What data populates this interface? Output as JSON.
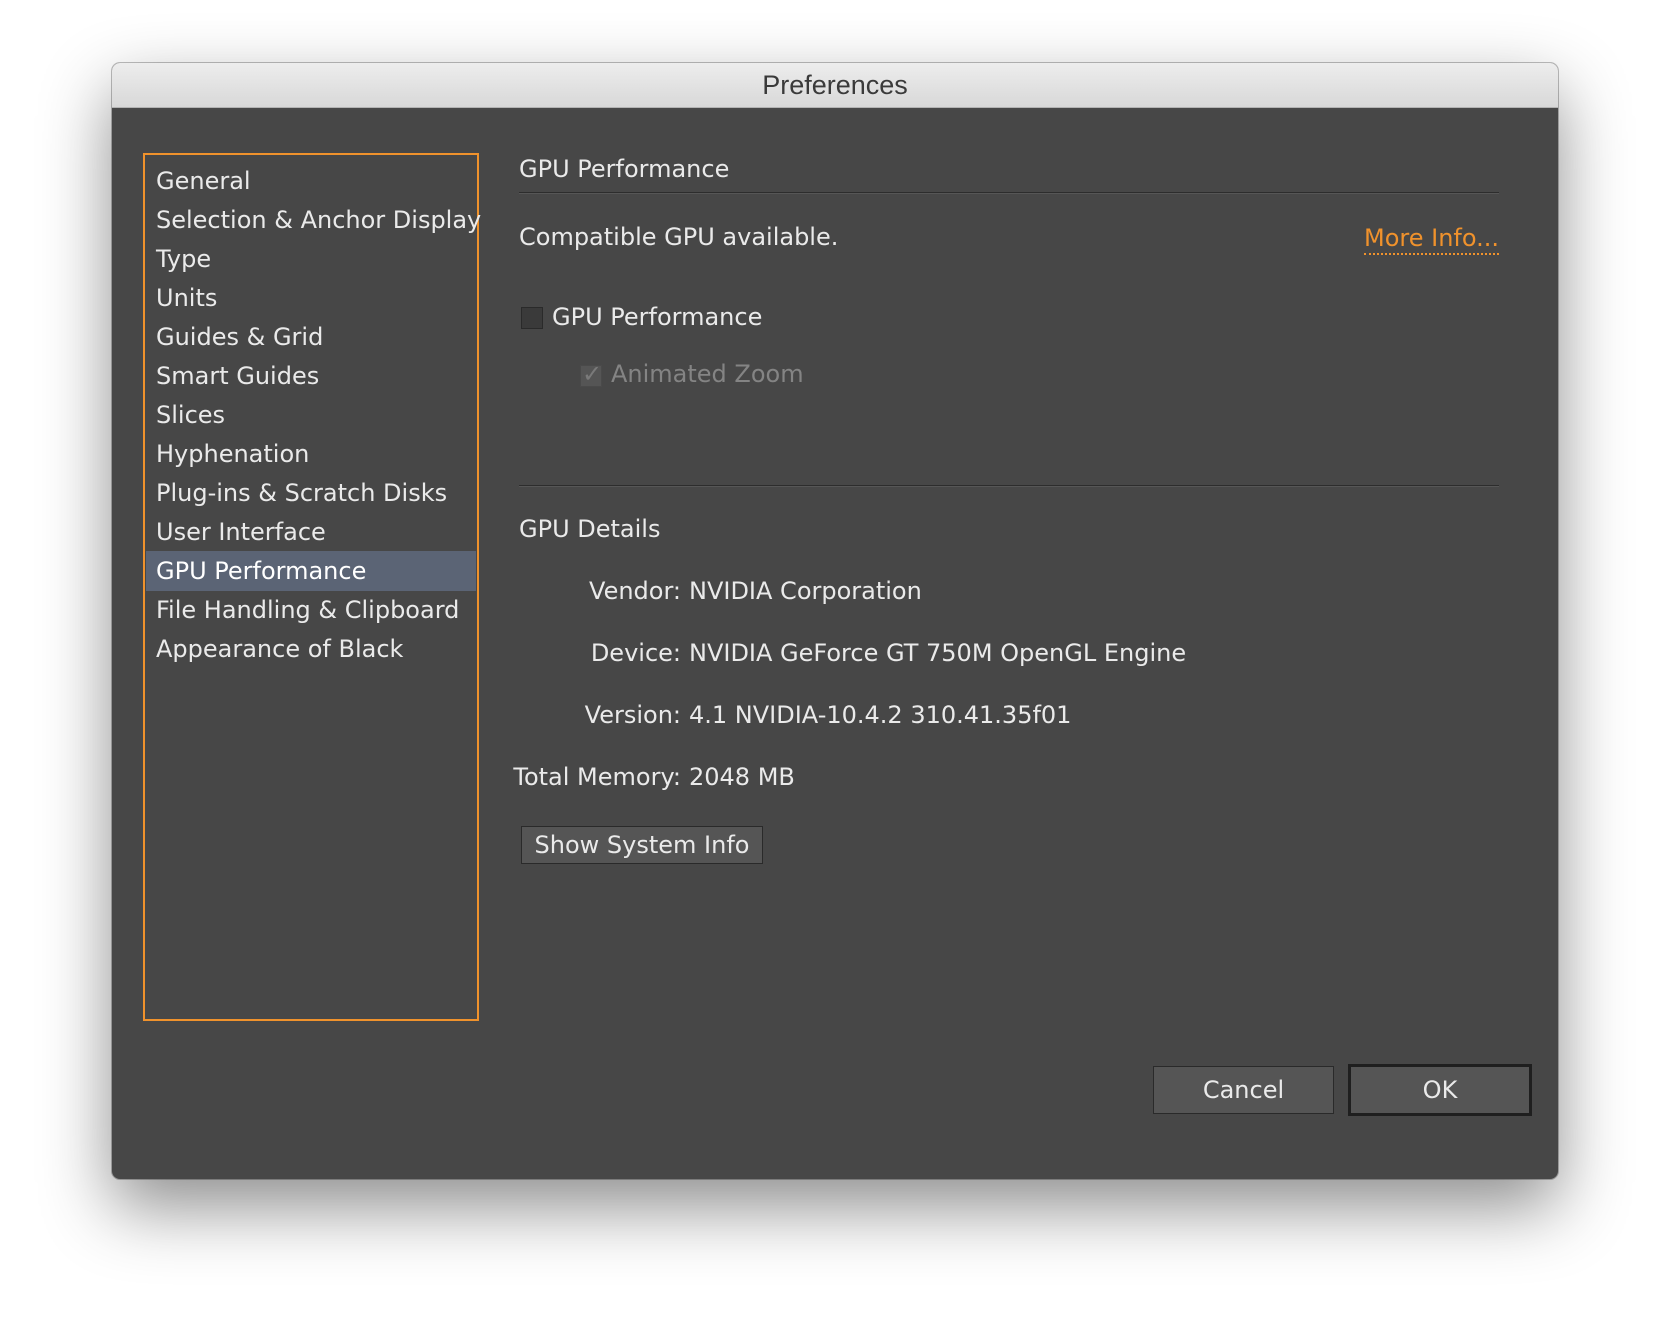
{
  "window": {
    "title": "Preferences"
  },
  "sidebar": {
    "items": [
      {
        "label": "General"
      },
      {
        "label": "Selection & Anchor Display"
      },
      {
        "label": "Type"
      },
      {
        "label": "Units"
      },
      {
        "label": "Guides & Grid"
      },
      {
        "label": "Smart Guides"
      },
      {
        "label": "Slices"
      },
      {
        "label": "Hyphenation"
      },
      {
        "label": "Plug-ins & Scratch Disks"
      },
      {
        "label": "User Interface"
      },
      {
        "label": "GPU Performance",
        "selected": true
      },
      {
        "label": "File Handling & Clipboard"
      },
      {
        "label": "Appearance of Black"
      }
    ]
  },
  "main": {
    "section_title": "GPU Performance",
    "status_text": "Compatible GPU available.",
    "more_info_link": "More Info...",
    "gpu_performance_checkbox": {
      "label": "GPU Performance",
      "checked": false
    },
    "animated_zoom_checkbox": {
      "label": "Animated Zoom",
      "checked": true,
      "enabled": false
    },
    "details_title": "GPU Details",
    "details": {
      "vendor_label": "Vendor:",
      "vendor_value": "NVIDIA Corporation",
      "device_label": "Device:",
      "device_value": "NVIDIA GeForce GT 750M OpenGL Engine",
      "version_label": "Version:",
      "version_value": "4.1 NVIDIA-10.4.2 310.41.35f01",
      "memory_label": "Total Memory:",
      "memory_value": "2048 MB"
    },
    "show_system_info_button": "Show System Info"
  },
  "footer": {
    "cancel_label": "Cancel",
    "ok_label": "OK"
  },
  "colors": {
    "accent": "#f0922c",
    "panel_bg": "#474747",
    "selected_bg": "#5b6475"
  },
  "icons": {
    "checkmark": "check-icon"
  }
}
